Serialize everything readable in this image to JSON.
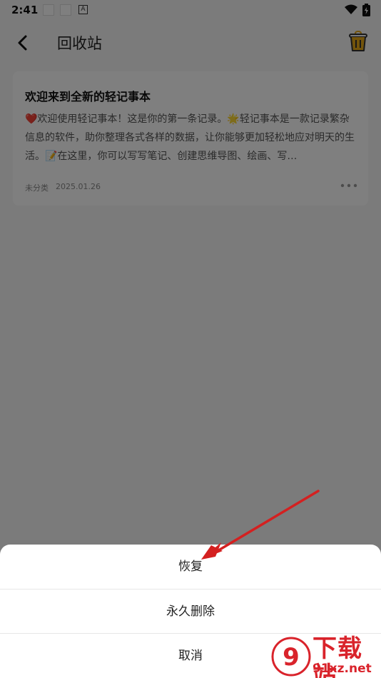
{
  "status_bar": {
    "time": "2:41",
    "app_glyph": "A"
  },
  "header": {
    "title": "回收站"
  },
  "note": {
    "title": "欢迎来到全新的轻记事本",
    "body": "❤️欢迎使用轻记事本！这是你的第一条记录。🌟轻记事本是一款记录繁杂信息的软件，助你整理各式各样的数据，让你能够更加轻松地应对明天的生活。📝在这里，你可以写写笔记、创建思维导图、绘画、写…",
    "category": "未分类",
    "date": "2025.01.26"
  },
  "action_sheet": {
    "restore": "恢复",
    "delete_forever": "永久删除",
    "cancel": "取消"
  },
  "watermark": {
    "title": "下载站",
    "url": "91xz.net",
    "logo_text": "9"
  },
  "colors": {
    "accent": "#e6a817",
    "watermark": "#d9232b",
    "arrow": "#d42020"
  }
}
